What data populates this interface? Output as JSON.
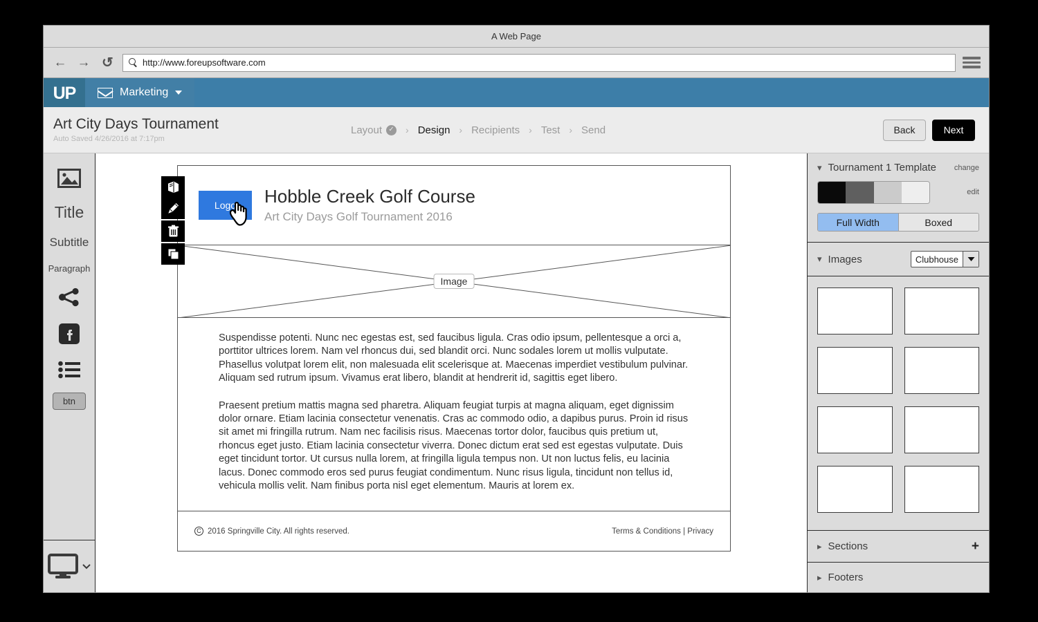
{
  "browser": {
    "window_title": "A Web Page",
    "url": "http://www.foreupsoftware.com",
    "back_icon": "arrow-left-icon",
    "forward_icon": "arrow-right-icon",
    "reload_icon": "reload-icon",
    "menu_icon": "hamburger-menu-icon"
  },
  "appnav": {
    "brand": "UP",
    "menu_label": "Marketing"
  },
  "header": {
    "title": "Art City Days Tournament",
    "autosave": "Auto Saved 4/26/2016 at 7:17pm",
    "steps": [
      {
        "label": "Layout",
        "state": "complete"
      },
      {
        "label": "Design",
        "state": "active"
      },
      {
        "label": "Recipients",
        "state": "pending"
      },
      {
        "label": "Test",
        "state": "pending"
      },
      {
        "label": "Send",
        "state": "pending"
      }
    ],
    "back_label": "Back",
    "next_label": "Next"
  },
  "tools": {
    "items": [
      {
        "name": "image-tool",
        "label": "",
        "icon": "image-icon"
      },
      {
        "name": "title-tool",
        "label": "Title",
        "icon": ""
      },
      {
        "name": "subtitle-tool",
        "label": "Subtitle",
        "icon": ""
      },
      {
        "name": "paragraph-tool",
        "label": "Paragraph",
        "icon": ""
      },
      {
        "name": "share-tool",
        "label": "",
        "icon": "share-icon"
      },
      {
        "name": "facebook-tool",
        "label": "",
        "icon": "facebook-icon"
      },
      {
        "name": "list-tool",
        "label": "",
        "icon": "bullet-list-icon"
      },
      {
        "name": "button-tool",
        "label": "btn",
        "icon": ""
      }
    ],
    "preview_icon": "desktop-monitor-icon"
  },
  "block_toolbar": {
    "items": [
      {
        "name": "layers-button",
        "icon": "layers-icon"
      },
      {
        "name": "edit-button",
        "icon": "pencil-icon"
      },
      {
        "name": "delete-button",
        "icon": "trash-icon"
      },
      {
        "name": "duplicate-button",
        "icon": "copy-icon"
      }
    ]
  },
  "email": {
    "logo_label": "Logo",
    "heading": "Hobble Creek Golf Course",
    "subheading": "Art City Days Golf Tournament 2016",
    "image_placeholder": "Image",
    "paragraphs": [
      "Suspendisse potenti. Nunc nec egestas est, sed faucibus ligula. Cras odio ipsum, pellentesque a orci a, porttitor ultrices lorem. Nam vel rhoncus dui, sed blandit orci. Nunc sodales lorem ut mollis vulputate. Phasellus volutpat lorem elit, non malesuada elit scelerisque at. Maecenas imperdiet vestibulum pulvinar. Aliquam sed rutrum ipsum. Vivamus erat libero, blandit at hendrerit id, sagittis eget libero.",
      "Praesent pretium mattis magna sed pharetra. Aliquam feugiat turpis at magna aliquam, eget dignissim dolor ornare. Etiam lacinia consectetur venenatis. Cras ac commodo odio, a dapibus purus. Proin id risus sit amet mi fringilla rutrum. Nam nec facilisis risus. Maecenas tortor dolor, faucibus quis pretium ut, rhoncus eget justo. Etiam lacinia consectetur viverra. Donec dictum erat sed est egestas vulputate. Duis eget tincidunt tortor. Ut cursus nulla lorem, at fringilla ligula tempus non. Ut non luctus felis, eu lacinia lacus. Donec commodo eros sed purus feugiat condimentum. Nunc risus ligula, tincidunt non tellus id, vehicula mollis velit. Nam finibus porta nisl eget elementum. Mauris at lorem ex."
    ],
    "footer": {
      "copyright_symbol": "C",
      "copyright": "2016 Springville City. All rights reserved.",
      "terms": "Terms & Conditions",
      "separator": "|",
      "privacy": "Privacy"
    }
  },
  "panel": {
    "template": {
      "title": "Tournament 1 Template",
      "change_label": "change",
      "edit_label": "edit",
      "swatches": [
        "#0a0a0a",
        "#5f5f5f",
        "#cbcbcb",
        "#eeeeee"
      ],
      "width_options": [
        {
          "label": "Full Width",
          "selected": true
        },
        {
          "label": "Boxed",
          "selected": false
        }
      ]
    },
    "images": {
      "title": "Images",
      "selected_category": "Clubhouse",
      "thumbnail_count": 8
    },
    "sections": {
      "title": "Sections",
      "add_icon": "plus-icon"
    },
    "footers": {
      "title": "Footers"
    }
  },
  "colors": {
    "nav_blue": "#3d7ea8",
    "logo_blue": "#2f79df",
    "accent_selected": "#93bdf0",
    "panel_bg": "#dcdcdc"
  }
}
